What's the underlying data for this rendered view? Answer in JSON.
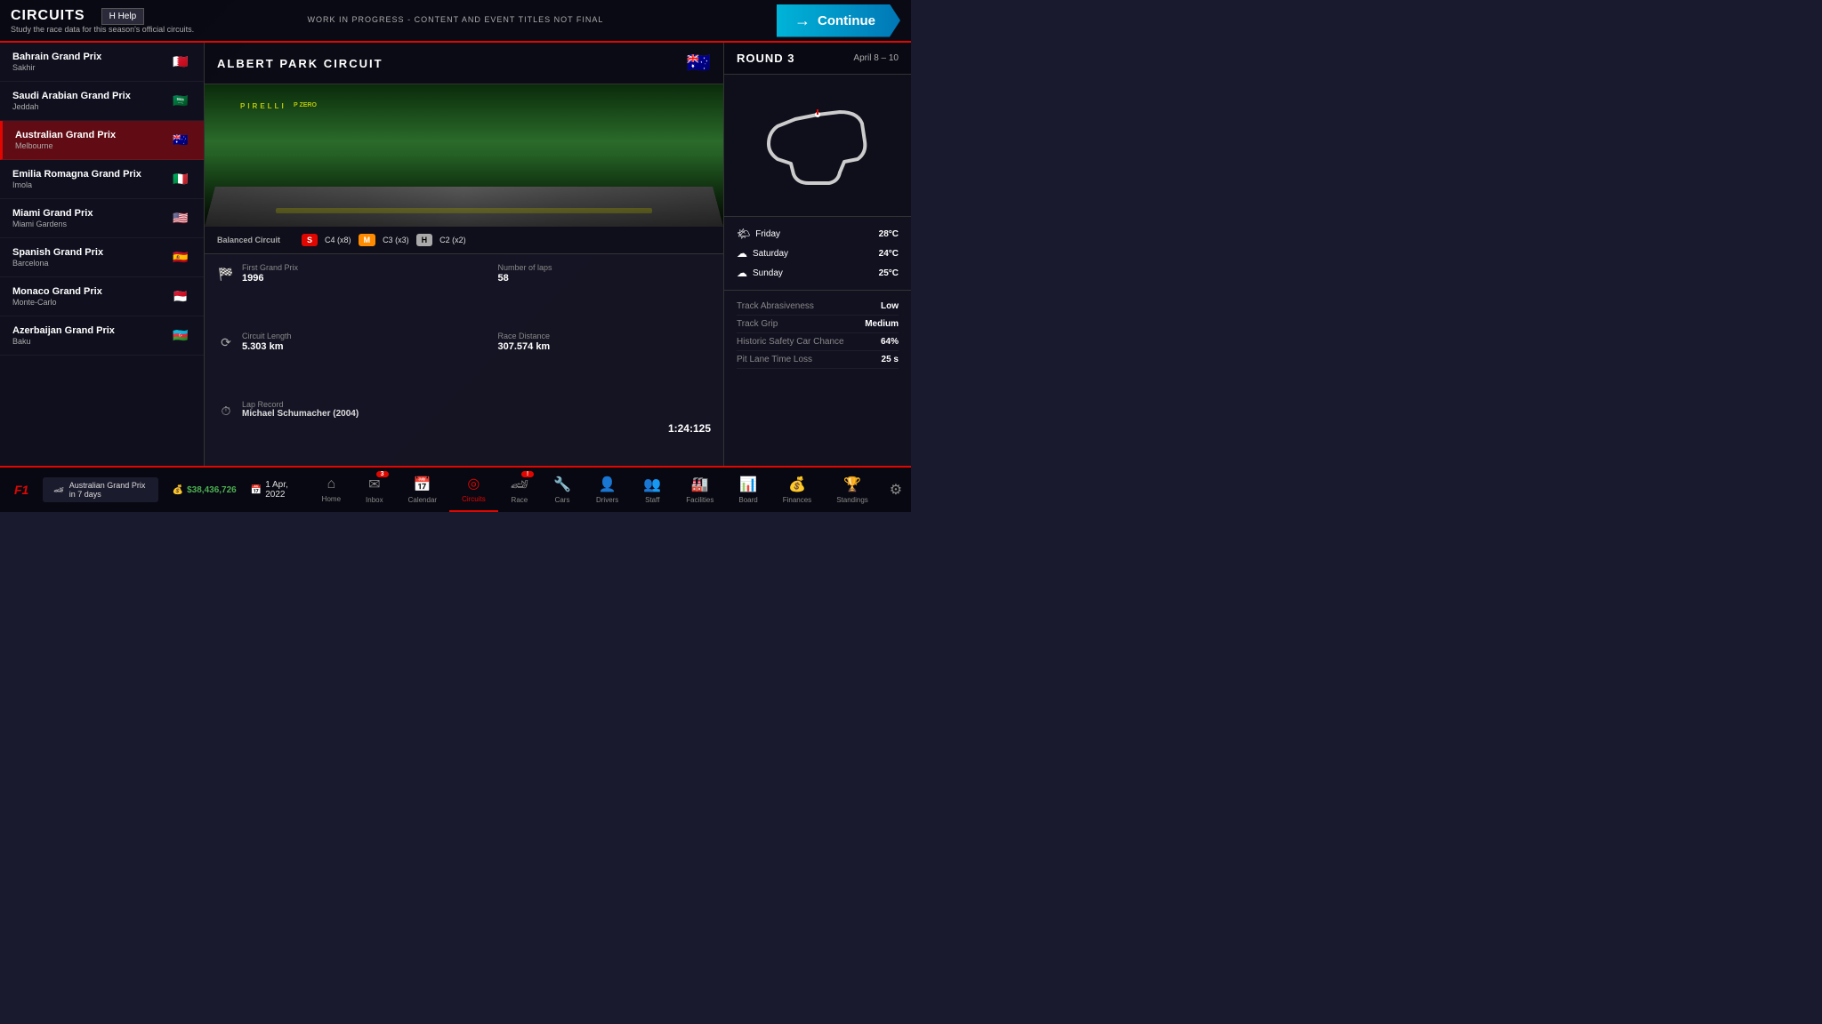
{
  "header": {
    "title": "Circuits",
    "subtitle": "Study the race data for this season's official circuits.",
    "help_label": "H  Help",
    "wip_notice": "WORK IN PROGRESS - CONTENT AND EVENT TITLES NOT FINAL",
    "continue_label": "Continue"
  },
  "circuits": [
    {
      "id": "bahrain",
      "name": "Bahrain Grand Prix",
      "city": "Sakhir",
      "flag": "🇧🇭",
      "active": false
    },
    {
      "id": "saudi",
      "name": "Saudi Arabian Grand Prix",
      "city": "Jeddah",
      "flag": "🇸🇦",
      "active": false
    },
    {
      "id": "australia",
      "name": "Australian Grand Prix",
      "city": "Melbourne",
      "flag": "🇦🇺",
      "active": true
    },
    {
      "id": "emilia",
      "name": "Emilia Romagna Grand Prix",
      "city": "Imola",
      "flag": "🇮🇹",
      "active": false
    },
    {
      "id": "miami",
      "name": "Miami Grand Prix",
      "city": "Miami Gardens",
      "flag": "🇺🇸",
      "active": false
    },
    {
      "id": "spanish",
      "name": "Spanish Grand Prix",
      "city": "Barcelona",
      "flag": "🇪🇸",
      "active": false
    },
    {
      "id": "monaco",
      "name": "Monaco Grand Prix",
      "city": "Monte-Carlo",
      "flag": "🇲🇨",
      "active": false
    },
    {
      "id": "azerbaijan",
      "name": "Azerbaijan Grand Prix",
      "city": "Baku",
      "flag": "🇦🇿",
      "active": false
    }
  ],
  "circuit_detail": {
    "name": "ALBERT PARK CIRCUIT",
    "flag": "🇦🇺",
    "circuit_type": "Balanced Circuit",
    "tires": [
      {
        "code": "S",
        "label": "C4",
        "count": "x8",
        "class": "tire-s"
      },
      {
        "code": "M",
        "label": "C3",
        "count": "x3",
        "class": "tire-m"
      },
      {
        "code": "H",
        "label": "C2",
        "count": "x2",
        "class": "tire-h"
      }
    ],
    "first_gp_label": "First Grand Prix",
    "first_gp_value": "1996",
    "laps_label": "Number of laps",
    "laps_value": "58",
    "length_label": "Circuit Length",
    "length_value": "5.303 km",
    "distance_label": "Race Distance",
    "distance_value": "307.574 km",
    "lap_record_label": "Lap Record",
    "lap_record_holder": "Michael Schumacher (2004)",
    "lap_record_time": "1:24:125"
  },
  "round": {
    "label": "ROUND 3",
    "dates": "April 8 – 10"
  },
  "weather": [
    {
      "day": "Friday",
      "icon": "🌤",
      "temp": "28°C"
    },
    {
      "day": "Saturday",
      "icon": "☁",
      "temp": "24°C"
    },
    {
      "day": "Sunday",
      "icon": "☁",
      "temp": "25°C"
    }
  ],
  "track_stats": [
    {
      "label": "Track Abrasiveness",
      "value": "Low"
    },
    {
      "label": "Track Grip",
      "value": "Medium"
    },
    {
      "label": "Historic Safety Car Chance",
      "value": "64%"
    },
    {
      "label": "Pit Lane Time Loss",
      "value": "25 s"
    }
  ],
  "status_bar": {
    "notification": "Australian Grand Prix in 7 days",
    "money": "$38,436,726",
    "date": "1 Apr, 2022"
  },
  "nav": {
    "tabs": [
      {
        "id": "home",
        "label": "Home",
        "icon": "⌂",
        "badge": null,
        "active": false
      },
      {
        "id": "inbox",
        "label": "Inbox",
        "icon": "✉",
        "badge": "3",
        "active": false
      },
      {
        "id": "calendar",
        "label": "Calendar",
        "icon": "📅",
        "badge": null,
        "active": false
      },
      {
        "id": "circuits",
        "label": "Circuits",
        "icon": "◎",
        "badge": null,
        "active": true
      },
      {
        "id": "race",
        "label": "Race",
        "icon": "🏎",
        "badge": "!",
        "active": false
      },
      {
        "id": "cars",
        "label": "Cars",
        "icon": "🔧",
        "badge": null,
        "active": false
      },
      {
        "id": "drivers",
        "label": "Drivers",
        "icon": "👤",
        "badge": null,
        "active": false
      },
      {
        "id": "staff",
        "label": "Staff",
        "icon": "👥",
        "badge": null,
        "active": false
      },
      {
        "id": "facilities",
        "label": "Facilities",
        "icon": "🏭",
        "badge": null,
        "active": false
      },
      {
        "id": "board",
        "label": "Board",
        "icon": "📊",
        "badge": null,
        "active": false
      },
      {
        "id": "finances",
        "label": "Finances",
        "icon": "💰",
        "badge": null,
        "active": false
      },
      {
        "id": "standings",
        "label": "Standings",
        "icon": "🏆",
        "badge": null,
        "active": false
      }
    ]
  }
}
